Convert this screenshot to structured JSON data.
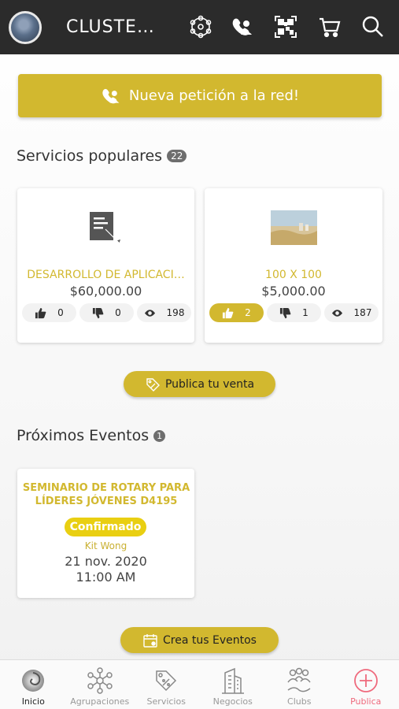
{
  "header": {
    "title": "CLUSTE…",
    "icons": [
      "network-icon",
      "support-agent-icon",
      "qr-code-icon",
      "cart-icon",
      "search-icon"
    ]
  },
  "request_button": {
    "label": "Nueva petición a la red!",
    "icon": "support-agent-icon"
  },
  "services": {
    "title": "Servicios populares",
    "count": "22",
    "items": [
      {
        "name": "DESARROLLO DE APLICACI…",
        "price": "$60,000.00",
        "likes": "0",
        "dislikes": "0",
        "views": "198",
        "liked": false,
        "image": "document-edit-icon"
      },
      {
        "name": "100 X 100",
        "price": "$5,000.00",
        "likes": "2",
        "dislikes": "1",
        "views": "187",
        "liked": true,
        "image": "landscape-thumbnail"
      }
    ]
  },
  "sell_button": {
    "label": "Publica tu venta",
    "icon": "tag-percent-icon"
  },
  "events": {
    "title": "Próximos Eventos",
    "count": "1",
    "items": [
      {
        "title": "SEMINARIO DE ROTARY PARA LÍDERES JÓVENES D4195",
        "status": "Confirmado",
        "organizer": "Kit Wong",
        "date": "21  nov. 2020",
        "time": "11:00 AM"
      }
    ]
  },
  "events_button": {
    "label": "Crea tus Eventos",
    "icon": "calendar-icon"
  },
  "bottom_nav": [
    {
      "label": "Inicio",
      "icon": "home-swirl-icon",
      "current": true
    },
    {
      "label": "Agrupaciones",
      "icon": "network-icon"
    },
    {
      "label": "Servicios",
      "icon": "discount-tag-icon"
    },
    {
      "label": "Negocios",
      "icon": "building-icon"
    },
    {
      "label": "Clubs",
      "icon": "people-icon"
    },
    {
      "label": "Publica",
      "icon": "add-circle-icon"
    }
  ],
  "colors": {
    "accent": "#d2b82f",
    "topbar": "#2b2b2b",
    "confirm": "#e9cf12",
    "publish": "#ef6a7d"
  }
}
